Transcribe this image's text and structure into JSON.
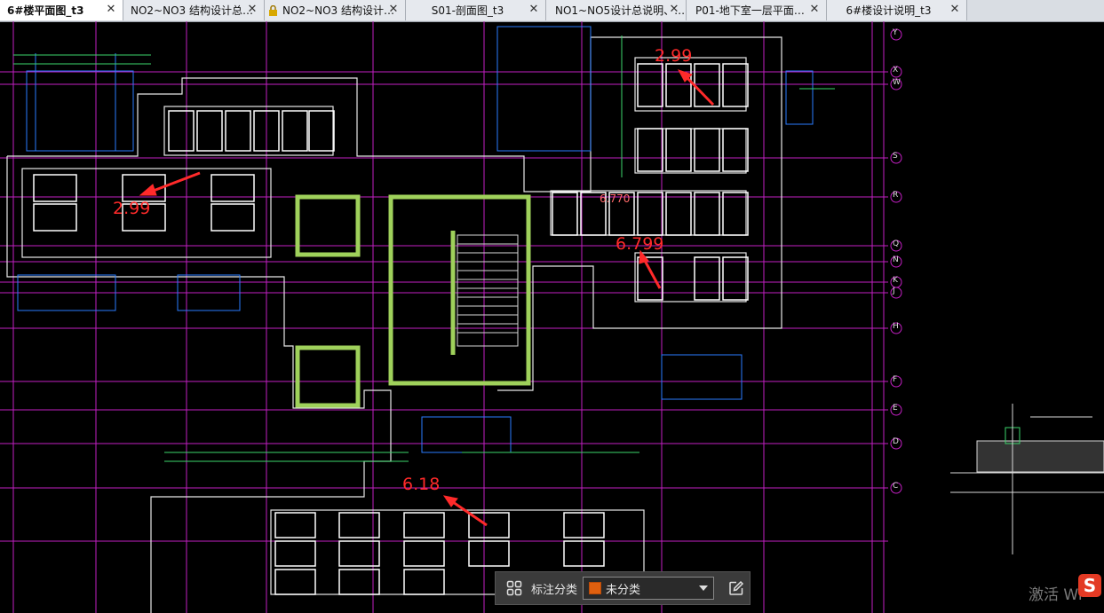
{
  "tabs": [
    {
      "label": "6#楼平面图_t3",
      "active": true
    },
    {
      "label": "NO2~NO3 结构设计总…",
      "active": false
    },
    {
      "label": "NO2~NO3 结构设计…",
      "active": false,
      "locked": true
    },
    {
      "label": "S01-剖面图_t3",
      "active": false
    },
    {
      "label": "NO1~NO5设计总说明、…",
      "active": false
    },
    {
      "label": "P01-地下室一层平面…",
      "active": false
    },
    {
      "label": "6#楼设计说明_t3",
      "active": false
    }
  ],
  "tab_close_glyph": "✕",
  "annotations": {
    "a1": "2.99",
    "a2": "2.99",
    "a3": "6.799",
    "a4": "6.18",
    "a5": "6.770"
  },
  "grid_axis_labels": [
    "Y",
    "X",
    "W",
    "S",
    "R",
    "Q",
    "N",
    "K",
    "J",
    "H",
    "F",
    "E",
    "D",
    "C"
  ],
  "toolbar": {
    "grid_icon": "grid-icon",
    "label": "标注分类",
    "select_value": "未分类",
    "select_color": "#e0600f",
    "edit_icon": "edit-icon"
  },
  "watermark": {
    "text": "激活 Wi",
    "logo": "S"
  },
  "colors": {
    "annotation": "#ff2a2a",
    "grid": "#cc22cc",
    "wall": "#9fd15b",
    "background": "#000000"
  }
}
